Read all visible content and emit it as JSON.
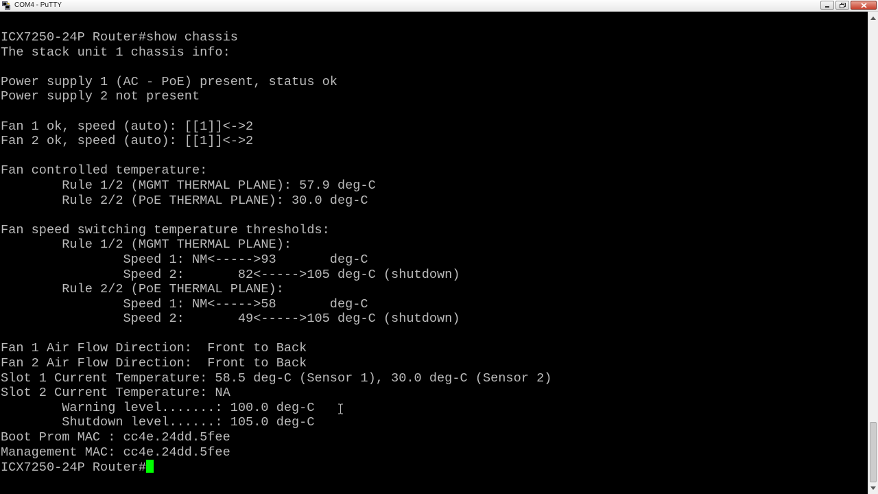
{
  "window": {
    "title": "COM4 - PuTTY",
    "icon": "putty-icon"
  },
  "terminal": {
    "lines": [
      "ICX7250-24P Router#show chassis",
      "The stack unit 1 chassis info:",
      "",
      "Power supply 1 (AC - PoE) present, status ok",
      "Power supply 2 not present",
      "",
      "Fan 1 ok, speed (auto): [[1]]<->2",
      "Fan 2 ok, speed (auto): [[1]]<->2",
      "",
      "Fan controlled temperature:",
      "        Rule 1/2 (MGMT THERMAL PLANE): 57.9 deg-C",
      "        Rule 2/2 (PoE THERMAL PLANE): 30.0 deg-C",
      "",
      "Fan speed switching temperature thresholds:",
      "        Rule 1/2 (MGMT THERMAL PLANE):",
      "                Speed 1: NM<----->93       deg-C",
      "                Speed 2:       82<----->105 deg-C (shutdown)",
      "        Rule 2/2 (PoE THERMAL PLANE):",
      "                Speed 1: NM<----->58       deg-C",
      "                Speed 2:       49<----->105 deg-C (shutdown)",
      "",
      "Fan 1 Air Flow Direction:  Front to Back",
      "Fan 2 Air Flow Direction:  Front to Back",
      "Slot 1 Current Temperature: 58.5 deg-C (Sensor 1), 30.0 deg-C (Sensor 2)",
      "Slot 2 Current Temperature: NA",
      "        Warning level.......: 100.0 deg-C",
      "        Shutdown level......: 105.0 deg-C",
      "Boot Prom MAC : cc4e.24dd.5fee",
      "Management MAC: cc4e.24dd.5fee"
    ],
    "prompt": "ICX7250-24P Router#",
    "text_color": "#bbbbbb",
    "cursor_color": "#00ff00",
    "background": "#000000"
  },
  "scrollbar": {
    "position": "bottom"
  }
}
